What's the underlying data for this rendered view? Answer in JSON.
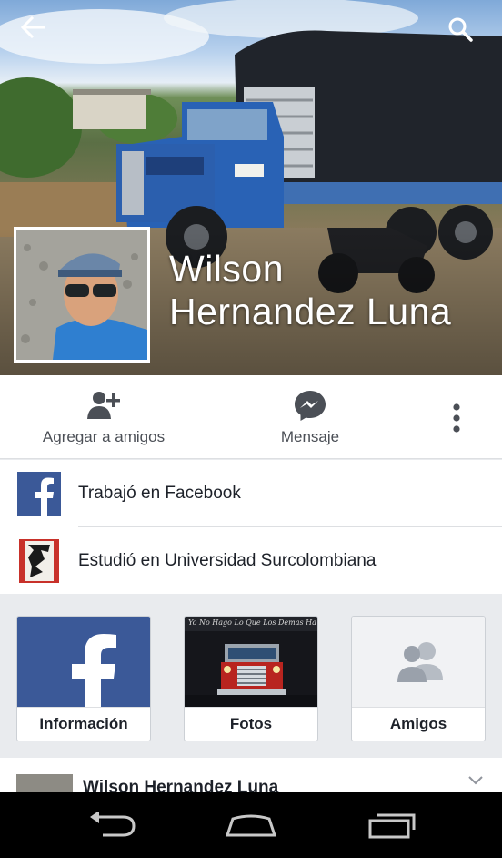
{
  "header": {
    "back_icon": "arrow-left-icon",
    "search_icon": "search-icon"
  },
  "profile": {
    "name_line1": "Wilson",
    "name_line2": "Hernandez Luna"
  },
  "actions": {
    "add_friend": "Agregar a amigos",
    "message": "Mensaje",
    "more_icon": "more-vertical-icon"
  },
  "info": {
    "work": "Trabajó en Facebook",
    "study": "Estudió en Universidad Surcolombiana"
  },
  "tiles": {
    "info": "Información",
    "photos": "Fotos",
    "friends": "Amigos",
    "photo_caption_top": "Yo No Hago Lo Que Los Demas Hacen..."
  },
  "post": {
    "author": "Wilson Hernandez Luna"
  },
  "colors": {
    "facebook_blue": "#3b5998",
    "text_dark": "#1d2129",
    "text_gray": "#4b4f56",
    "background": "#e9ebee"
  }
}
